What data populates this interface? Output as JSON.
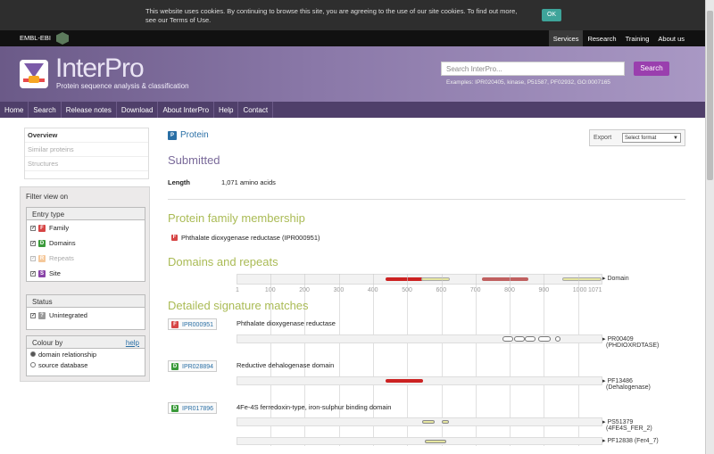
{
  "cookie": {
    "text": "This website uses cookies. By continuing to browse this site, you are agreeing to the use of our site cookies. To find out more, see our Terms of Use.",
    "ok": "OK"
  },
  "topbar": {
    "ebi": "EMBL-EBI",
    "nav": [
      "Services",
      "Research",
      "Training",
      "About us"
    ]
  },
  "banner": {
    "brand": "InterPro",
    "tagline": "Protein sequence analysis & classification",
    "search_placeholder": "Search InterPro...",
    "search_button": "Search",
    "examples": "Examples: IPR020405, kinase, P51587, PF02932, GO:0007165"
  },
  "mainnav": [
    "Home",
    "Search",
    "Release notes",
    "Download",
    "About InterPro",
    "Help",
    "Contact"
  ],
  "sidebar": {
    "items": [
      "Overview",
      "Similar proteins",
      "Structures"
    ],
    "filter": {
      "title": "Filter view on",
      "entry_type": "Entry type",
      "types": [
        {
          "badge": "F",
          "label": "Family",
          "color": "#d64545"
        },
        {
          "badge": "D",
          "label": "Domains",
          "color": "#3a9a3a"
        },
        {
          "badge": "R",
          "label": "Repeats",
          "color": "#f0a050"
        },
        {
          "badge": "S",
          "label": "Site",
          "color": "#8a45a8"
        }
      ],
      "status": "Status",
      "unintegrated_badge": "?",
      "unintegrated": "Unintegrated",
      "colour_by": "Colour by",
      "help": "help",
      "colour_options": [
        "domain relationship",
        "source database"
      ]
    }
  },
  "main": {
    "title_badge": "P",
    "title": "Protein",
    "export_label": "Export",
    "export_select": "Select format",
    "submitted": "Submitted",
    "length_label": "Length",
    "length_value": "1,071 amino acids",
    "family_heading": "Protein family membership",
    "family_badge": "F",
    "family_entry": "Phthalate dioxygenase reductase (IPR000951)",
    "domains_heading": "Domains and repeats",
    "domain_label": "Domain",
    "ticks": [
      "1",
      "100",
      "200",
      "300",
      "400",
      "500",
      "600",
      "700",
      "800",
      "900",
      "1000",
      "1071"
    ],
    "signatures_heading": "Detailed signature matches",
    "signatures": [
      {
        "badge": "F",
        "color": "#d64545",
        "acc": "IPR000951",
        "name": "Phthalate dioxygenase reductase",
        "db": "PR00409",
        "db_name": "(PHDIOXRDTASE)"
      },
      {
        "badge": "D",
        "color": "#3a9a3a",
        "acc": "IPR028894",
        "name": "Reductive dehalogenase domain",
        "db": "PF13486",
        "db_name": "(Dehalogenase)"
      },
      {
        "badge": "D",
        "color": "#3a9a3a",
        "acc": "IPR017896",
        "name": "4Fe-4S ferredoxin-type, iron-sulphur binding domain",
        "db": "PS51379",
        "db_name": "(4FE4S_FER_2)",
        "db2": "PF12838 (Fer4_7)"
      }
    ]
  },
  "colors": {
    "accent": "#2a6fa5",
    "brand": "#6b5a88",
    "domain_red": "#cc2222",
    "domain_pink": "#c06060",
    "domain_yellow": "#e6e6a0"
  }
}
